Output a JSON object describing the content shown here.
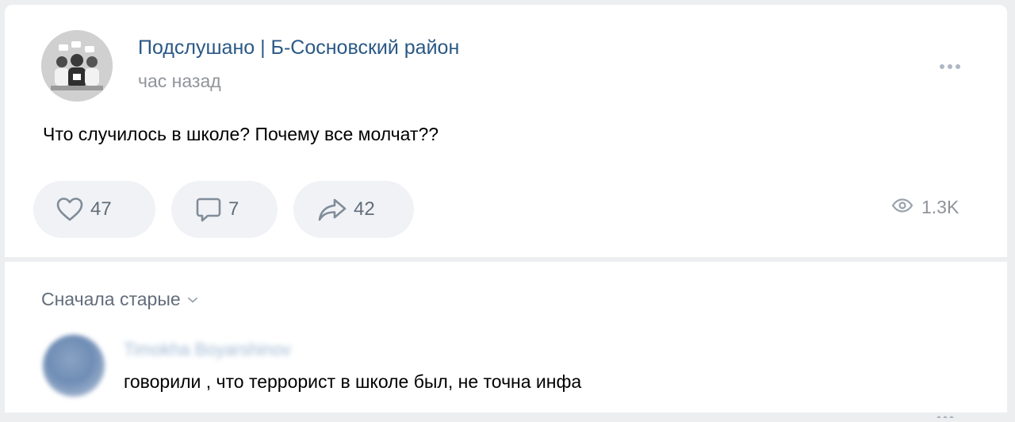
{
  "post": {
    "group_name": "Подслушано | Б-Сосновский район",
    "time": "час назад",
    "text": "Что случилось в школе? Почему все молчат??",
    "actions": {
      "likes": "47",
      "comments": "7",
      "shares": "42"
    },
    "views": "1.3K",
    "icons": {
      "avatar": "group-avatar-people-illustration",
      "more": "more-dots-icon",
      "like": "heart-icon",
      "comment": "comment-bubble-icon",
      "share": "share-arrow-icon",
      "views": "eye-icon"
    }
  },
  "comments": {
    "sort_label": "Сначала старые",
    "items": [
      {
        "author": "Timokha Boyarshinov",
        "text": "говорили , что террорист в школе был, не точна инфа"
      }
    ]
  },
  "colors": {
    "link": "#2a5885",
    "secondary": "#909499",
    "action_bg": "#f0f2f5",
    "page_bg": "#edeef0"
  }
}
